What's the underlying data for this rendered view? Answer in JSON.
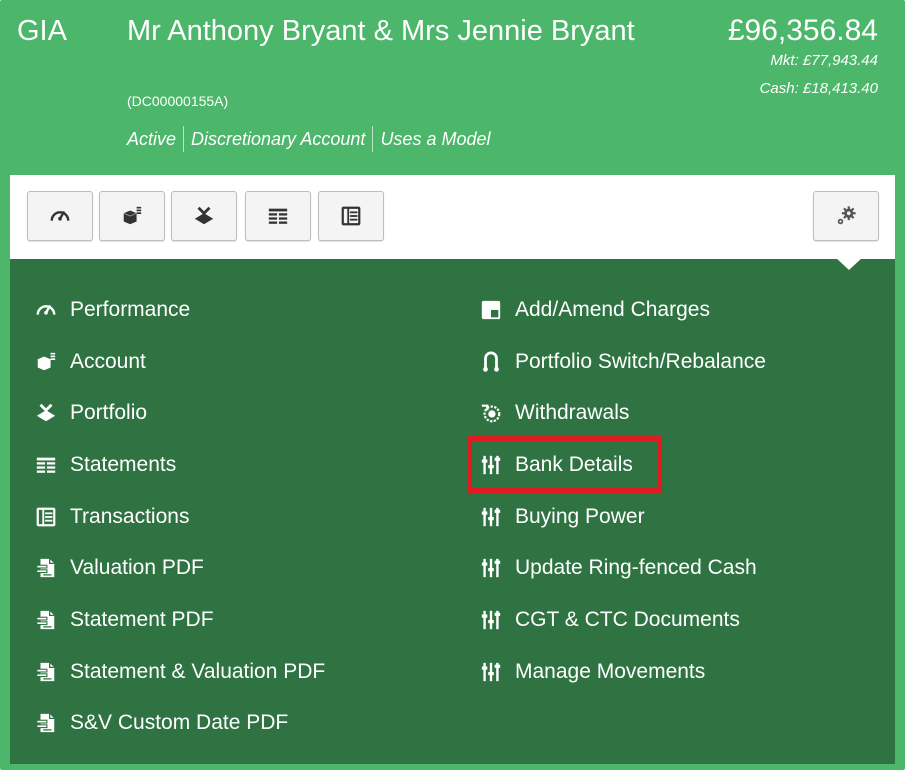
{
  "header": {
    "account_type": "GIA",
    "client_name": "Mr Anthony Bryant & Mrs Jennie Bryant",
    "client_ref": "(DC00000155A)",
    "status": [
      "Active",
      "Discretionary Account",
      "Uses a Model"
    ],
    "total_value": "£96,356.84",
    "market_value": "Mkt: £77,943.44",
    "cash_value": "Cash: £18,413.40"
  },
  "toolbar": {
    "buttons": [
      {
        "icon": "speedometer-icon"
      },
      {
        "icon": "account-cube-icon"
      },
      {
        "icon": "portfolio-icon"
      },
      {
        "icon": "statements-table-icon"
      },
      {
        "icon": "transactions-ledger-icon"
      }
    ],
    "settings_icon": "gears-icon"
  },
  "menu": {
    "left": [
      {
        "label": "Performance",
        "icon": "speedometer-icon"
      },
      {
        "label": "Account",
        "icon": "account-cube-icon"
      },
      {
        "label": "Portfolio",
        "icon": "portfolio-icon"
      },
      {
        "label": "Statements",
        "icon": "statements-table-icon"
      },
      {
        "label": "Transactions",
        "icon": "transactions-ledger-icon"
      },
      {
        "label": "Valuation PDF",
        "icon": "pdf-document-icon"
      },
      {
        "label": "Statement PDF",
        "icon": "pdf-document-icon"
      },
      {
        "label": "Statement & Valuation PDF",
        "icon": "pdf-document-icon"
      },
      {
        "label": "S&V Custom Date PDF",
        "icon": "pdf-document-icon"
      }
    ],
    "right": [
      {
        "label": "Add/Amend Charges",
        "icon": "charges-icon"
      },
      {
        "label": "Portfolio Switch/Rebalance",
        "icon": "switch-icon"
      },
      {
        "label": "Withdrawals",
        "icon": "withdrawals-icon"
      },
      {
        "label": "Bank Details",
        "icon": "sliders-icon"
      },
      {
        "label": "Buying Power",
        "icon": "sliders-icon"
      },
      {
        "label": "Update Ring-fenced Cash",
        "icon": "sliders-icon"
      },
      {
        "label": "CGT & CTC Documents",
        "icon": "sliders-icon"
      },
      {
        "label": "Manage Movements",
        "icon": "sliders-icon"
      }
    ]
  },
  "colors": {
    "header_green": "#4cb66b",
    "panel_green": "#2f7342",
    "highlight_red": "#e11b22"
  }
}
